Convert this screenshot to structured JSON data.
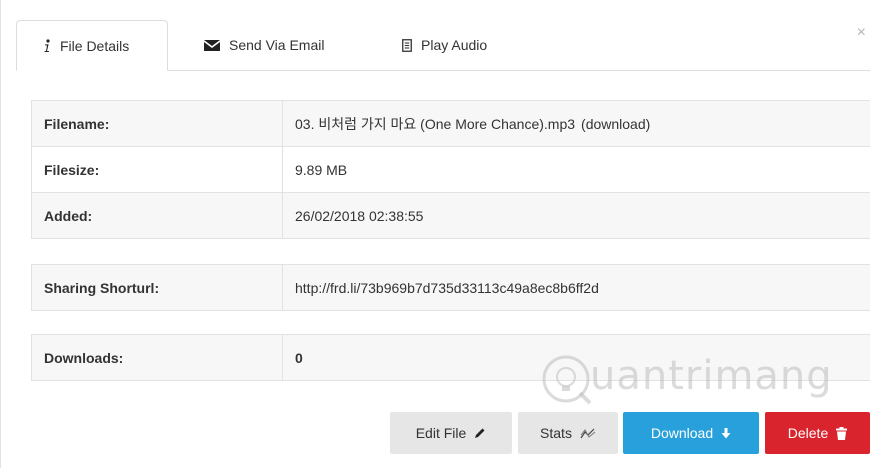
{
  "tabs": {
    "file_details": "File Details",
    "send_email": "Send Via Email",
    "play_audio": "Play Audio",
    "close": "×"
  },
  "details": {
    "filename_label": "Filename:",
    "filename_value": "03. 비처럼 가지 마요 (One More Chance).mp3",
    "download_link": "(download)",
    "filesize_label": "Filesize:",
    "filesize_value": "9.89 MB",
    "added_label": "Added:",
    "added_value": "26/02/2018 02:38:55",
    "shorturl_label": "Sharing Shorturl:",
    "shorturl_value": "http://frd.li/73b969b7d735d33113c49a8ec8b6ff2d",
    "downloads_label": "Downloads:",
    "downloads_value": "0"
  },
  "actions": {
    "edit": "Edit File",
    "stats": "Stats",
    "download": "Download",
    "delete": "Delete"
  },
  "watermark": {
    "text": "uantrimang"
  },
  "colors": {
    "download_bg": "#27a0db",
    "delete_bg": "#d9232d",
    "neutral_btn_bg": "#e6e6e6",
    "row_stripe": "#f7f7f7",
    "border": "#dddddd"
  },
  "icons": {
    "file_details": "info-icon",
    "send_email": "envelope-icon",
    "play_audio": "document-icon",
    "edit": "pencil-icon",
    "stats": "chart-line-icon",
    "download": "arrow-down-icon",
    "delete": "trash-icon"
  }
}
